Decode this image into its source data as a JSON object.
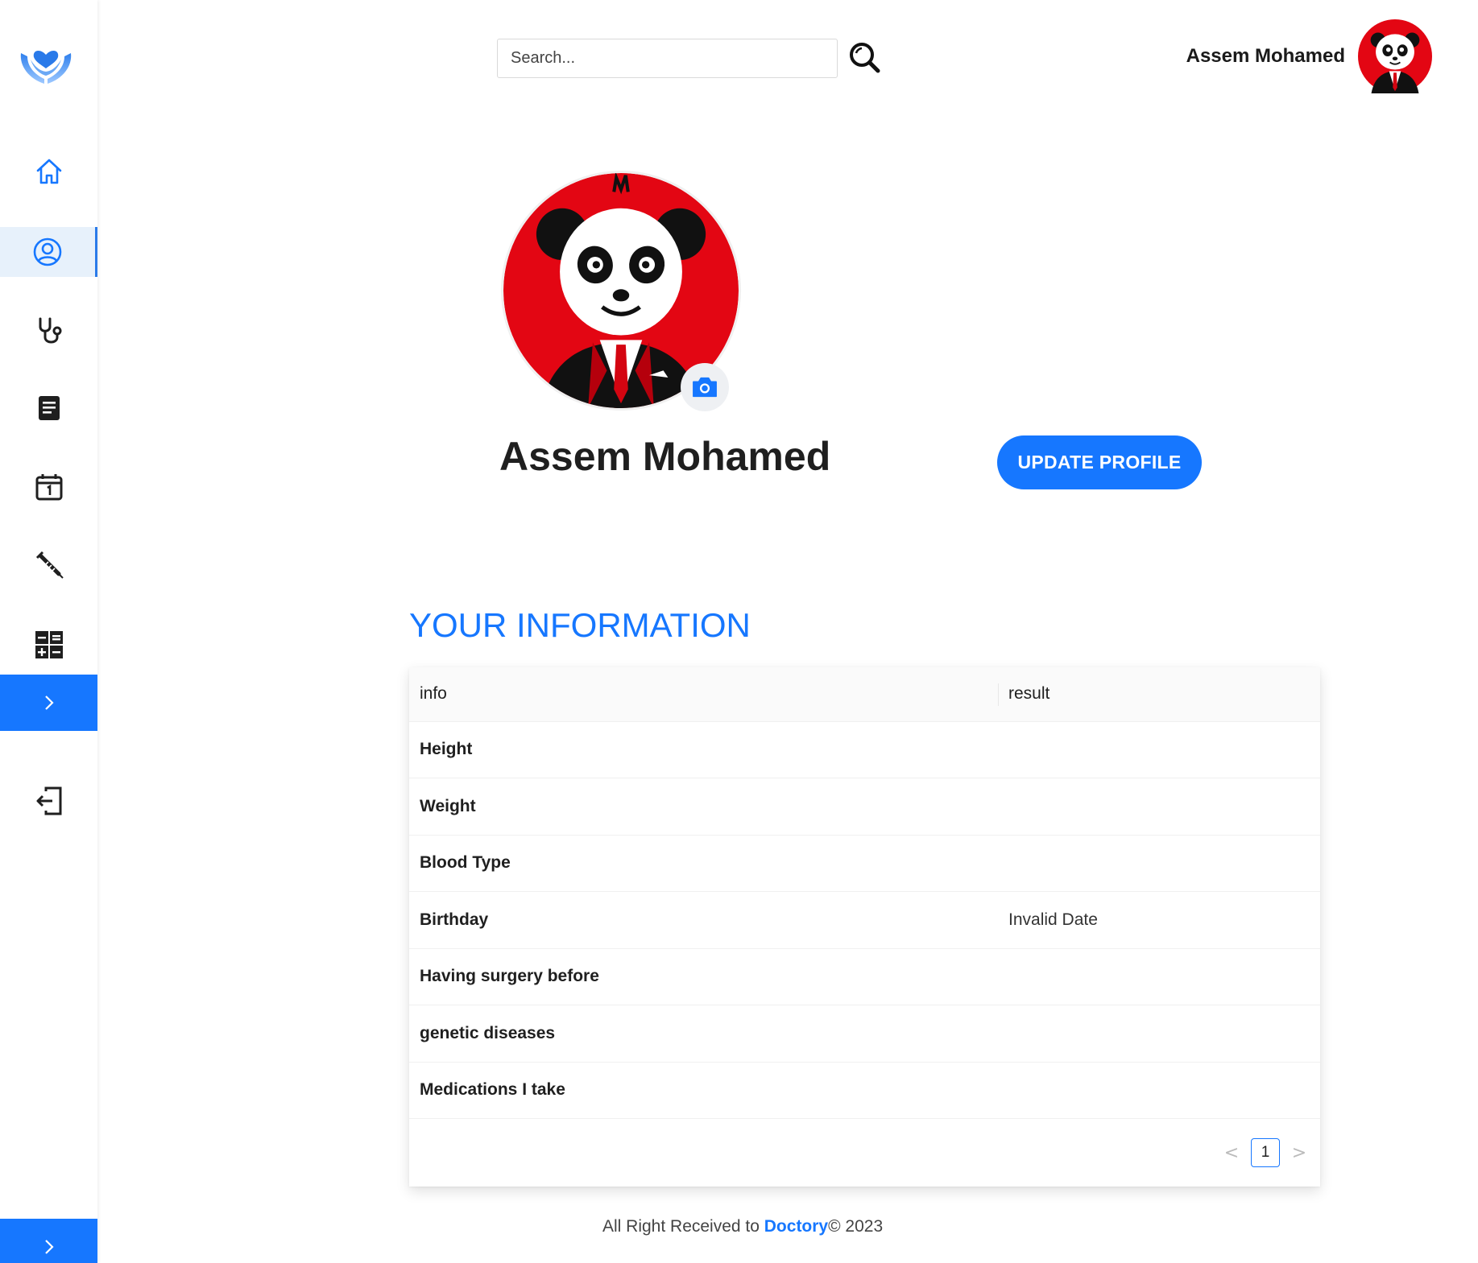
{
  "colors": {
    "primary": "#1677ff",
    "avatar_bg": "#e30613",
    "text": "#1f1f1f"
  },
  "sidebar": {
    "logo": "heart-hands-logo",
    "items": [
      {
        "name": "home",
        "icon": "home-icon"
      },
      {
        "name": "profile",
        "icon": "user-circle-icon",
        "active": true
      },
      {
        "name": "doctors",
        "icon": "stethoscope-icon"
      },
      {
        "name": "records",
        "icon": "document-icon"
      },
      {
        "name": "appointments",
        "icon": "calendar-icon"
      },
      {
        "name": "vaccines",
        "icon": "syringe-icon"
      },
      {
        "name": "calculator",
        "icon": "calculator-icon"
      },
      {
        "name": "logout",
        "icon": "logout-icon"
      }
    ],
    "expand_icon": "chevron-right-icon"
  },
  "header": {
    "search_placeholder": "Search...",
    "search_icon": "search-icon",
    "user_name": "Assem Mohamed"
  },
  "profile": {
    "name": "Assem Mohamed",
    "update_label": "UPDATE PROFILE",
    "camera_icon": "camera-icon"
  },
  "info_section": {
    "title": "YOUR INFORMATION",
    "columns": [
      "info",
      "result"
    ],
    "rows": [
      {
        "info": "Height",
        "result": ""
      },
      {
        "info": "Weight",
        "result": ""
      },
      {
        "info": "Blood Type",
        "result": ""
      },
      {
        "info": "Birthday",
        "result": "Invalid Date"
      },
      {
        "info": "Having surgery before",
        "result": ""
      },
      {
        "info": "genetic diseases",
        "result": ""
      },
      {
        "info": "Medications I take",
        "result": ""
      }
    ],
    "pagination": {
      "prev": "<",
      "current": "1",
      "next": ">"
    }
  },
  "footer": {
    "prefix": "All Right Received to ",
    "brand": "Doctory",
    "suffix": "© 2023"
  }
}
